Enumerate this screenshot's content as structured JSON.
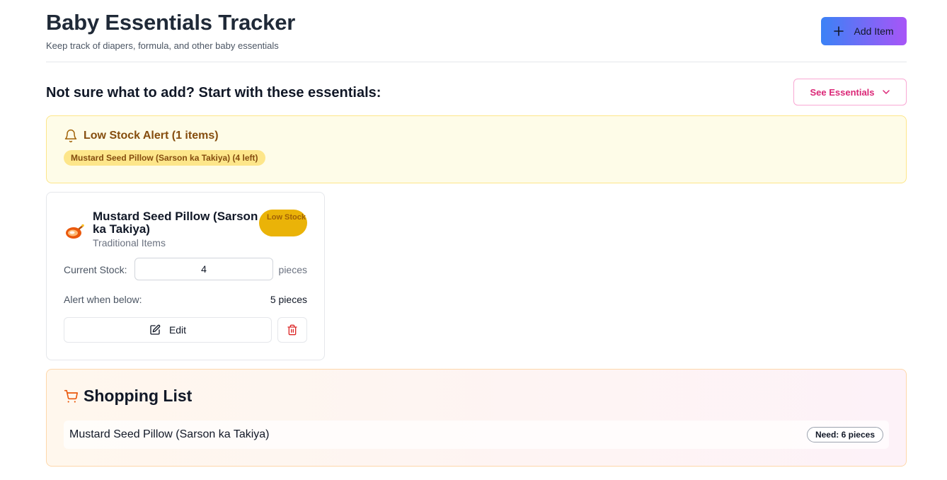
{
  "header": {
    "title": "Baby Essentials Tracker",
    "subtitle": "Keep track of diapers, formula, and other baby essentials",
    "add_label": "Add Item"
  },
  "essentials": {
    "prompt": "Not sure what to add? Start with these essentials:",
    "button_label": "See Essentials"
  },
  "alert": {
    "title": "Low Stock Alert (1 items)",
    "chips": [
      "Mustard Seed Pillow (Sarson ka Takiya) (4 left)"
    ]
  },
  "items": [
    {
      "name": "Mustard Seed Pillow (Sarson ka Takiya)",
      "category": "Traditional Items",
      "badge": "Low Stock",
      "stock_label": "Current Stock:",
      "stock_value": "4",
      "unit": "pieces",
      "alert_label": "Alert when below:",
      "alert_value": "5 pieces",
      "edit_label": "Edit"
    }
  ],
  "shopping": {
    "title": "Shopping List",
    "rows": [
      {
        "name": "Mustard Seed Pillow (Sarson ka Takiya)",
        "need": "Need: 6 pieces"
      }
    ]
  },
  "colors": {
    "accent_gradient_start": "#3b82f6",
    "accent_gradient_end": "#a855f7",
    "pink": "#db2777",
    "alert_bg": "#fefce8",
    "alert_text": "#854d0e",
    "badge_bg": "#eab308",
    "danger": "#dc2626",
    "cart": "#ea580c"
  },
  "icons": [
    "plus-icon",
    "chevron-down-icon",
    "bell-icon",
    "pillow-emoji-icon",
    "edit-icon",
    "trash-icon",
    "cart-icon"
  ]
}
